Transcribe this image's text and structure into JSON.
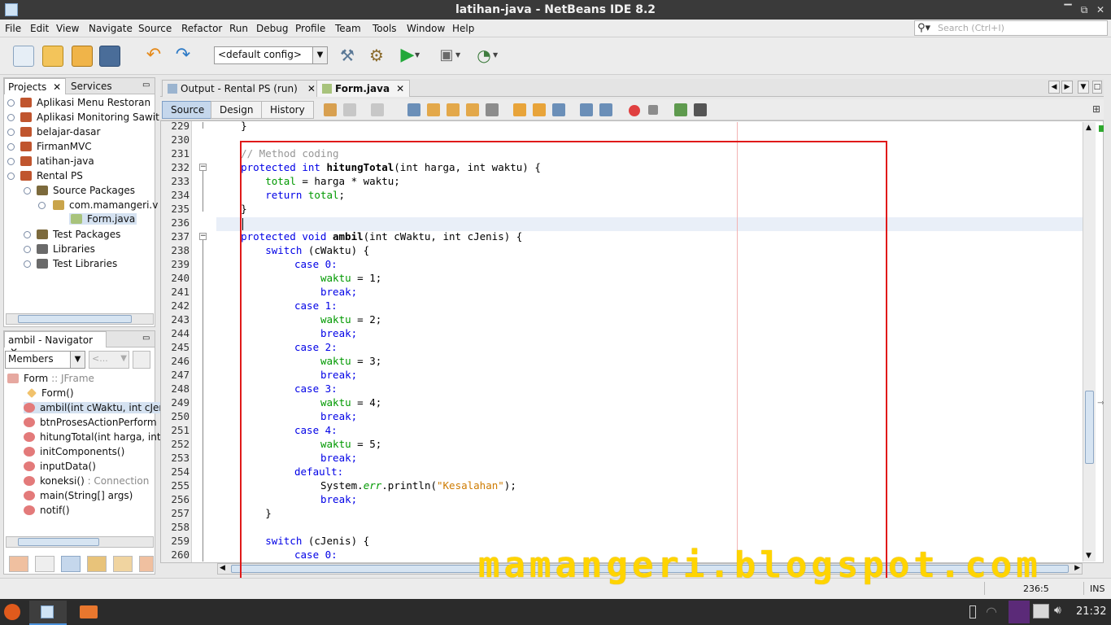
{
  "window": {
    "title": "latihan-java - NetBeans IDE 8.2"
  },
  "menu": [
    "File",
    "Edit",
    "View",
    "Navigate",
    "Source",
    "Refactor",
    "Run",
    "Debug",
    "Profile",
    "Team",
    "Tools",
    "Window",
    "Help"
  ],
  "search": {
    "placeholder": "Search (Ctrl+I)"
  },
  "toolbar": {
    "config": "<default config>"
  },
  "projects_panel": {
    "tabs": [
      "Projects",
      "Services"
    ],
    "items": [
      {
        "label": "Aplikasi Menu Restoran"
      },
      {
        "label": "Aplikasi Monitoring Sawit"
      },
      {
        "label": "belajar-dasar"
      },
      {
        "label": "FirmanMVC"
      },
      {
        "label": "latihan-java"
      },
      {
        "label": "Rental PS"
      },
      {
        "label": "Source Packages"
      },
      {
        "label": "com.mamangeri.v"
      },
      {
        "label": "Form.java"
      },
      {
        "label": "Test Packages"
      },
      {
        "label": "Libraries"
      },
      {
        "label": "Test Libraries"
      }
    ]
  },
  "navigator": {
    "title": "ambil - Navigator",
    "filter": "Members",
    "filter2": "<...",
    "root": "Form",
    "root_type": ":: JFrame",
    "members": [
      {
        "name": "Form()",
        "sig": ""
      },
      {
        "name": "ambil",
        "sig": "(int cWaktu, int cJen"
      },
      {
        "name": "btnProsesActionPerform",
        "sig": ""
      },
      {
        "name": "hitungTotal",
        "sig": "(int harga, int"
      },
      {
        "name": "initComponents()",
        "sig": ""
      },
      {
        "name": "inputData()",
        "sig": ""
      },
      {
        "name": "koneksi()",
        "sig": " : Connection"
      },
      {
        "name": "main",
        "sig": "(String[] args)"
      },
      {
        "name": "notif()",
        "sig": ""
      }
    ]
  },
  "editor": {
    "tabs": [
      "Output - Rental PS (run)",
      "Form.java"
    ],
    "views": [
      "Source",
      "Design",
      "History"
    ],
    "line_numbers": [
      "229",
      "230",
      "231",
      "232",
      "233",
      "234",
      "235",
      "236",
      "237",
      "238",
      "239",
      "240",
      "241",
      "242",
      "243",
      "244",
      "245",
      "246",
      "247",
      "248",
      "249",
      "250",
      "251",
      "252",
      "253",
      "254",
      "255",
      "256",
      "257",
      "258",
      "259",
      "260"
    ],
    "code": {
      "l229": "    }",
      "l231": "    // Method coding",
      "l232a": "    protected int ",
      "l232b": "hitungTotal",
      "l232c": "(int harga, int waktu) {",
      "l233a": "        ",
      "l233b": "total",
      "l233c": " = harga * waktu;",
      "l234a": "        return ",
      "l234b": "total",
      "l234c": ";",
      "l235": "    }",
      "l237a": "    protected void ",
      "l237b": "ambil",
      "l237c": "(int cWaktu, int cJenis) {",
      "l238a": "        switch",
      "l238b": " (cWaktu) {",
      "case0": "case 0:",
      "case1": "case 1:",
      "case2": "case 2:",
      "case3": "case 3:",
      "case4": "case 4:",
      "waktu": "waktu",
      "v1": " = 1;",
      "v2": " = 2;",
      "v3": " = 3;",
      "v4": " = 4;",
      "v5": " = 5;",
      "brk": "break;",
      "def": "default:",
      "l255a": "System.",
      "l255b": "err",
      "l255c": ".println(",
      "l255d": "\"Kesalahan\"",
      "l255e": ");",
      "l257": "        }",
      "l259a": "        switch",
      "l259b": " (cJenis) {"
    }
  },
  "status": {
    "position": "236:5",
    "mode": "INS"
  },
  "taskbar": {
    "clock": "21:32"
  },
  "watermark": "mamangeri.blogspot.com"
}
